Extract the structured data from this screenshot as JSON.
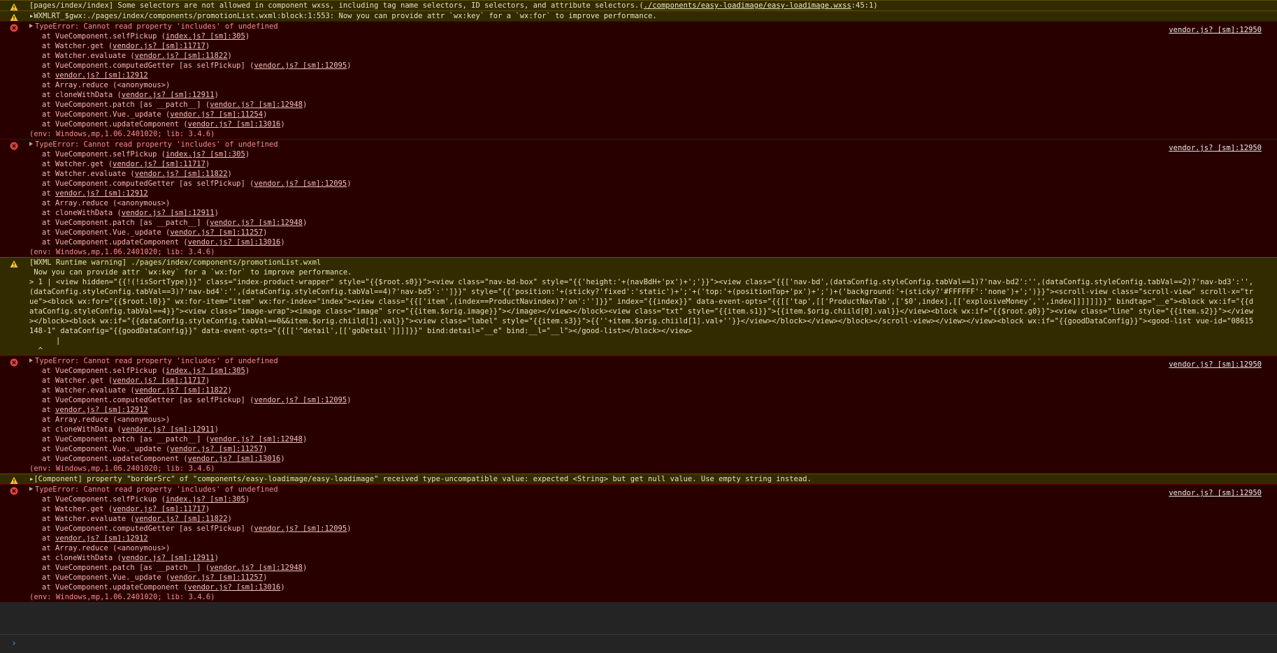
{
  "console": {
    "prompt_symbol": "›",
    "entries": [
      {
        "level": "warning",
        "lines": [
          {
            "parts": [
              {
                "t": "[pages/index/index] Some selectors are not allowed in component wxss, including tag name selectors, ID selectors, and attribute selectors.("
              },
              {
                "t": "./components/easy-loadimage/easy-loadimage.wxss",
                "link": true
              },
              {
                "t": ":45:1)"
              }
            ]
          }
        ]
      },
      {
        "level": "warning",
        "lines": [
          {
            "parts": [
              {
                "t": "▸WXMLRT_$gwx:./pages/index/components/promotionList.wxml:block:1:553: Now you can provide attr `wx:key` for a `wx:for` to improve performance."
              }
            ]
          }
        ]
      },
      {
        "level": "error",
        "source": "vendor.js? [sm]:12950",
        "header": "TypeError: Cannot read property 'includes' of undefined",
        "stack": [
          {
            "parts": [
              {
                "t": "at VueComponent.selfPickup ("
              },
              {
                "t": "index.js? [sm]:305",
                "link": true
              },
              {
                "t": ")"
              }
            ]
          },
          {
            "parts": [
              {
                "t": "at Watcher.get ("
              },
              {
                "t": "vendor.js? [sm]:11717",
                "link": true
              },
              {
                "t": ")"
              }
            ]
          },
          {
            "parts": [
              {
                "t": "at Watcher.evaluate ("
              },
              {
                "t": "vendor.js? [sm]:11822",
                "link": true
              },
              {
                "t": ")"
              }
            ]
          },
          {
            "parts": [
              {
                "t": "at VueComponent.computedGetter [as selfPickup] ("
              },
              {
                "t": "vendor.js? [sm]:12095",
                "link": true
              },
              {
                "t": ")"
              }
            ]
          },
          {
            "parts": [
              {
                "t": "at "
              },
              {
                "t": "vendor.js? [sm]:12912",
                "link": true
              }
            ]
          },
          {
            "parts": [
              {
                "t": "at Array.reduce (<anonymous>)"
              }
            ]
          },
          {
            "parts": [
              {
                "t": "at cloneWithData ("
              },
              {
                "t": "vendor.js? [sm]:12911",
                "link": true
              },
              {
                "t": ")"
              }
            ]
          },
          {
            "parts": [
              {
                "t": "at VueComponent.patch [as __patch__] ("
              },
              {
                "t": "vendor.js? [sm]:12948",
                "link": true
              },
              {
                "t": ")"
              }
            ]
          },
          {
            "parts": [
              {
                "t": "at VueComponent.Vue._update ("
              },
              {
                "t": "vendor.js? [sm]:11254",
                "link": true
              },
              {
                "t": ")"
              }
            ]
          },
          {
            "parts": [
              {
                "t": "at VueComponent.updateComponent ("
              },
              {
                "t": "vendor.js? [sm]:13016",
                "link": true
              },
              {
                "t": ")"
              }
            ]
          }
        ],
        "footer": "(env: Windows,mp,1.06.2401020; lib: 3.4.6)"
      },
      {
        "level": "error",
        "source": "vendor.js? [sm]:12950",
        "header": "TypeError: Cannot read property 'includes' of undefined",
        "stack": [
          {
            "parts": [
              {
                "t": "at VueComponent.selfPickup ("
              },
              {
                "t": "index.js? [sm]:305",
                "link": true
              },
              {
                "t": ")"
              }
            ]
          },
          {
            "parts": [
              {
                "t": "at Watcher.get ("
              },
              {
                "t": "vendor.js? [sm]:11717",
                "link": true
              },
              {
                "t": ")"
              }
            ]
          },
          {
            "parts": [
              {
                "t": "at Watcher.evaluate ("
              },
              {
                "t": "vendor.js? [sm]:11822",
                "link": true
              },
              {
                "t": ")"
              }
            ]
          },
          {
            "parts": [
              {
                "t": "at VueComponent.computedGetter [as selfPickup] ("
              },
              {
                "t": "vendor.js? [sm]:12095",
                "link": true
              },
              {
                "t": ")"
              }
            ]
          },
          {
            "parts": [
              {
                "t": "at "
              },
              {
                "t": "vendor.js? [sm]:12912",
                "link": true
              }
            ]
          },
          {
            "parts": [
              {
                "t": "at Array.reduce (<anonymous>)"
              }
            ]
          },
          {
            "parts": [
              {
                "t": "at cloneWithData ("
              },
              {
                "t": "vendor.js? [sm]:12911",
                "link": true
              },
              {
                "t": ")"
              }
            ]
          },
          {
            "parts": [
              {
                "t": "at VueComponent.patch [as __patch__] ("
              },
              {
                "t": "vendor.js? [sm]:12948",
                "link": true
              },
              {
                "t": ")"
              }
            ]
          },
          {
            "parts": [
              {
                "t": "at VueComponent.Vue._update ("
              },
              {
                "t": "vendor.js? [sm]:11257",
                "link": true
              },
              {
                "t": ")"
              }
            ]
          },
          {
            "parts": [
              {
                "t": "at VueComponent.updateComponent ("
              },
              {
                "t": "vendor.js? [sm]:13016",
                "link": true
              },
              {
                "t": ")"
              }
            ]
          }
        ],
        "footer": "(env: Windows,mp,1.06.2401020; lib: 3.4.6)"
      },
      {
        "level": "warning",
        "lines": [
          {
            "parts": [
              {
                "t": "[WXML Runtime warning] ./pages/index/components/promotionList.wxml"
              }
            ]
          },
          {
            "parts": [
              {
                "t": " Now you can provide attr `wx:key` for a `wx:for` to improve performance."
              }
            ]
          }
        ],
        "code": "> 1 | <view hidden=\"{{!(!isSortType)}}\" class=\"index-product-wrapper\" style=\"{{$root.s0}}\"><view class=\"nav-bd-box\" style=\"{{'height:'+(navBdH+'px')+';'}}\"><view class=\"{{['nav-bd',(dataConfig.styleConfig.tabVal==1)?'nav-bd2':'',(dataConfig.styleConfig.tabVal==2)?'nav-bd3':'',(dataConfig.styleConfig.tabVal==3)?'nav-bd4':'',(dataConfig.styleConfig.tabVal==4)?'nav-bd5':'']}}\" style=\"{{'position:'+(sticky?'fixed':'static')+';'+('top:'+(positionTop+'px')+';')+('background:'+(sticky?'#FFFFFF':'none')+';')}}\"><scroll-view class=\"scroll-view\" scroll-x=\"true\"><block wx:for=\"{{$root.l0}}\" wx:for-item=\"item\" wx:for-index=\"index\"><view class=\"{{['item',(index==ProductNavindex)?'on':'']}}\" index=\"{{index}}\" data-event-opts=\"{{[['tap',[['ProductNavTab',['$0',index],[['explosiveMoney','',index]]]]]]}}\" bindtap=\"__e\"><block wx:if=\"{{dataConfig.styleConfig.tabVal==4}}\"><view class=\"image-wrap\"><image class=\"image\" src=\"{{item.$orig.image}}\"></image></view></block><view class=\"txt\" style=\"{{item.s1}}\">{{item.$orig.chiild[0].val}}</view><block wx:if=\"{{$root.g0}}\"><view class=\"line\" style=\"{{item.s2}}\"></view></block><block wx:if=\"{{dataConfig.styleConfig.tabVal==0&&item.$orig.chiild[1].val}}\"><view class=\"label\" style=\"{{item.s3}}\">{{''+item.$orig.chiild[1].val+''}}</view></block></view></block></scroll-view></view></view><block wx:if=\"{{goodDataConfig}}\"><good-list vue-id=\"08615148-1\" dataConfig=\"{{goodDataConfig}}\" data-event-opts=\"{{[['^detail',[['goDetail']]]]}}\" bind:detail=\"__e\" bind:__l=\"__l\"></good-list></block></view>\n      |\n  ^"
      },
      {
        "level": "error",
        "source": "vendor.js? [sm]:12950",
        "header": "TypeError: Cannot read property 'includes' of undefined",
        "stack": [
          {
            "parts": [
              {
                "t": "at VueComponent.selfPickup ("
              },
              {
                "t": "index.js? [sm]:305",
                "link": true
              },
              {
                "t": ")"
              }
            ]
          },
          {
            "parts": [
              {
                "t": "at Watcher.get ("
              },
              {
                "t": "vendor.js? [sm]:11717",
                "link": true
              },
              {
                "t": ")"
              }
            ]
          },
          {
            "parts": [
              {
                "t": "at Watcher.evaluate ("
              },
              {
                "t": "vendor.js? [sm]:11822",
                "link": true
              },
              {
                "t": ")"
              }
            ]
          },
          {
            "parts": [
              {
                "t": "at VueComponent.computedGetter [as selfPickup] ("
              },
              {
                "t": "vendor.js? [sm]:12095",
                "link": true
              },
              {
                "t": ")"
              }
            ]
          },
          {
            "parts": [
              {
                "t": "at "
              },
              {
                "t": "vendor.js? [sm]:12912",
                "link": true
              }
            ]
          },
          {
            "parts": [
              {
                "t": "at Array.reduce (<anonymous>)"
              }
            ]
          },
          {
            "parts": [
              {
                "t": "at cloneWithData ("
              },
              {
                "t": "vendor.js? [sm]:12911",
                "link": true
              },
              {
                "t": ")"
              }
            ]
          },
          {
            "parts": [
              {
                "t": "at VueComponent.patch [as __patch__] ("
              },
              {
                "t": "vendor.js? [sm]:12948",
                "link": true
              },
              {
                "t": ")"
              }
            ]
          },
          {
            "parts": [
              {
                "t": "at VueComponent.Vue._update ("
              },
              {
                "t": "vendor.js? [sm]:11257",
                "link": true
              },
              {
                "t": ")"
              }
            ]
          },
          {
            "parts": [
              {
                "t": "at VueComponent.updateComponent ("
              },
              {
                "t": "vendor.js? [sm]:13016",
                "link": true
              },
              {
                "t": ")"
              }
            ]
          }
        ],
        "footer": "(env: Windows,mp,1.06.2401020; lib: 3.4.6)"
      },
      {
        "level": "warning",
        "lines": [
          {
            "parts": [
              {
                "t": "▸[Component] property \"borderSrc\" of \"components/easy-loadimage/easy-loadimage\" received type-uncompatible value: expected <String> but get null value. Use empty string instead."
              }
            ]
          }
        ]
      },
      {
        "level": "error",
        "source": "vendor.js? [sm]:12950",
        "header": "TypeError: Cannot read property 'includes' of undefined",
        "stack": [
          {
            "parts": [
              {
                "t": "at VueComponent.selfPickup ("
              },
              {
                "t": "index.js? [sm]:305",
                "link": true
              },
              {
                "t": ")"
              }
            ]
          },
          {
            "parts": [
              {
                "t": "at Watcher.get ("
              },
              {
                "t": "vendor.js? [sm]:11717",
                "link": true
              },
              {
                "t": ")"
              }
            ]
          },
          {
            "parts": [
              {
                "t": "at Watcher.evaluate ("
              },
              {
                "t": "vendor.js? [sm]:11822",
                "link": true
              },
              {
                "t": ")"
              }
            ]
          },
          {
            "parts": [
              {
                "t": "at VueComponent.computedGetter [as selfPickup] ("
              },
              {
                "t": "vendor.js? [sm]:12095",
                "link": true
              },
              {
                "t": ")"
              }
            ]
          },
          {
            "parts": [
              {
                "t": "at "
              },
              {
                "t": "vendor.js? [sm]:12912",
                "link": true
              }
            ]
          },
          {
            "parts": [
              {
                "t": "at Array.reduce (<anonymous>)"
              }
            ]
          },
          {
            "parts": [
              {
                "t": "at cloneWithData ("
              },
              {
                "t": "vendor.js? [sm]:12911",
                "link": true
              },
              {
                "t": ")"
              }
            ]
          },
          {
            "parts": [
              {
                "t": "at VueComponent.patch [as __patch__] ("
              },
              {
                "t": "vendor.js? [sm]:12948",
                "link": true
              },
              {
                "t": ")"
              }
            ]
          },
          {
            "parts": [
              {
                "t": "at VueComponent.Vue._update ("
              },
              {
                "t": "vendor.js? [sm]:11257",
                "link": true
              },
              {
                "t": ")"
              }
            ]
          },
          {
            "parts": [
              {
                "t": "at VueComponent.updateComponent ("
              },
              {
                "t": "vendor.js? [sm]:13016",
                "link": true
              },
              {
                "t": ")"
              }
            ]
          }
        ],
        "footer": "(env: Windows,mp,1.06.2401020; lib: 3.4.6)"
      }
    ]
  }
}
